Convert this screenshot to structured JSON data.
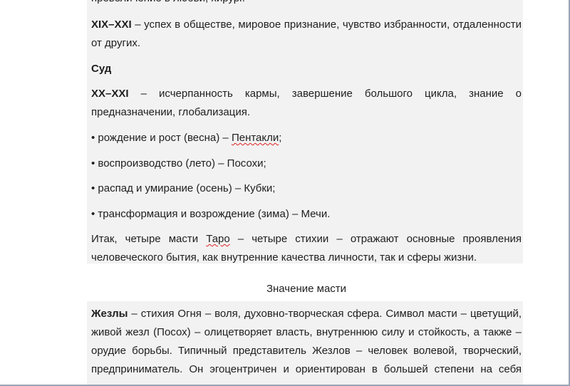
{
  "document": {
    "top_cut_line": "превеличение в любви, хирург.",
    "p_xix_term": "XIX–XXI",
    "p_xix_line1": " – успех в обществе, мировое признание, чувство избранности, отдаленности",
    "p_xix_line2": "от других.",
    "heading_sud": "Суд",
    "p_xx_term": "XX–XXI",
    "p_xx_line1": " – исчерпанность кармы, завершение большого цикла, знание о",
    "p_xx_line2": "предназначении, глобализация.",
    "bullet_1_prefix": "• рождение и рост (весна) – ",
    "bullet_1_word": "Пентакли",
    "bullet_1_suffix": ";",
    "bullet_2": "• воспроизводство (лето) – Посохи;",
    "bullet_3": "• распад и умирание (осень) – Кубки;",
    "bullet_4": "• трансформация и возрождение (зима) – Мечи.",
    "p_itak_prefix": "Итак, четыре масти ",
    "p_itak_word": "Таро",
    "p_itak_rest": " – четыре стихии – отражают основные проявления",
    "p_itak_line2": "человеческого бытия, как внутренние качества личности, так и сферы жизни.",
    "section_title": "Значение масти",
    "p_wands_term": "Жезлы",
    "p_wands_line1": " – стихия Огня – воля, духовно-творческая сфера. Символ масти – цветущий,",
    "p_wands_line2": "живой жезл (Посох) – олицетворяет власть, внутреннюю силу и стойкость, а также –",
    "p_wands_line3": "орудие борьбы. Типичный представитель Жезлов – человек волевой, творческий,",
    "p_wands_line4": "предприниматель. Он эгоцентричен и ориентирован в большей степени на себя"
  }
}
